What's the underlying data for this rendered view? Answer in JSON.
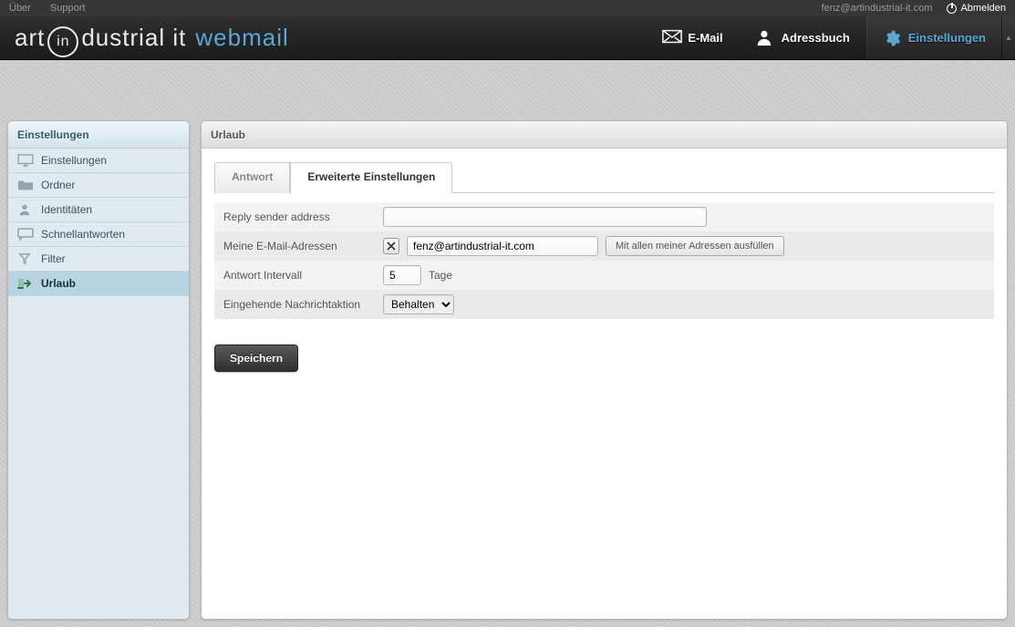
{
  "utilbar": {
    "about": "Über",
    "support": "Support",
    "user_email": "fenz@artindustrial-it.com",
    "logout": "Abmelden"
  },
  "logo": {
    "brand_pre": "art",
    "brand_in": "in",
    "brand_post": "dustrial it",
    "product": "webmail"
  },
  "nav": {
    "mail": "E-Mail",
    "contacts": "Adressbuch",
    "settings": "Einstellungen"
  },
  "sidebar": {
    "title": "Einstellungen",
    "items": [
      {
        "label": "Einstellungen"
      },
      {
        "label": "Ordner"
      },
      {
        "label": "Identitäten"
      },
      {
        "label": "Schnellantworten"
      },
      {
        "label": "Filter"
      },
      {
        "label": "Urlaub"
      }
    ]
  },
  "main": {
    "title": "Urlaub",
    "tabs": {
      "reply": "Antwort",
      "advanced": "Erweiterte Einstellungen"
    },
    "rows": {
      "reply_sender_label": "Reply sender address",
      "reply_sender_value": "",
      "my_addr_label": "Meine E-Mail-Adressen",
      "my_addr_value": "fenz@artindustrial-it.com",
      "fill_all_btn": "Mit allen meiner Adressen ausfüllen",
      "interval_label": "Antwort Intervall",
      "interval_value": "5",
      "interval_unit": "Tage",
      "incoming_label": "Eingehende Nachrichtaktion",
      "incoming_selected": "Behalten"
    },
    "save": "Speichern"
  }
}
